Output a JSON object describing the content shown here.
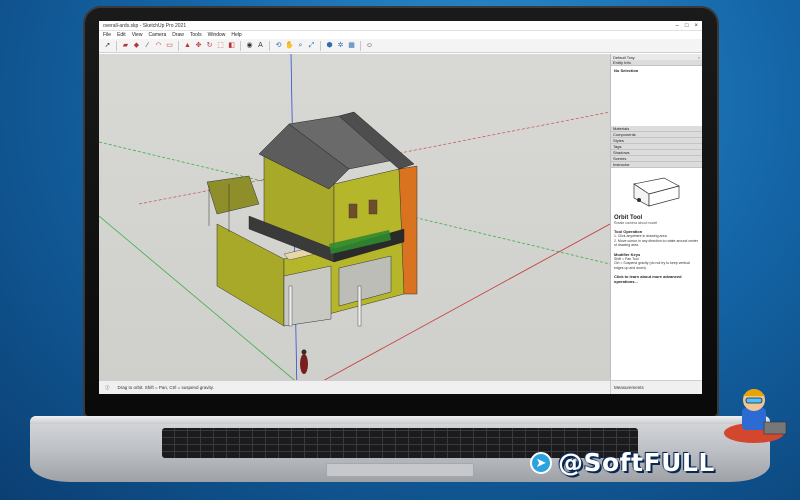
{
  "app": {
    "title": "overall-ards.skp - SketchUp Pro 2021",
    "menu": [
      "File",
      "Edit",
      "View",
      "Camera",
      "Draw",
      "Tools",
      "Window",
      "Help"
    ]
  },
  "toolbar": {
    "icons": [
      "select-icon",
      "eraser-icon",
      "paint-bucket-icon",
      "line-icon",
      "arc-icon",
      "shapes-icon",
      "push-pull-icon",
      "move-icon",
      "rotate-icon",
      "scale-icon",
      "offset-icon",
      "tape-measure-icon",
      "text-icon",
      "orbit-icon",
      "pan-icon",
      "zoom-icon",
      "zoom-extents-icon",
      "3d-warehouse-icon",
      "extension-warehouse-icon",
      "layout-icon",
      "account-icon"
    ]
  },
  "tray": {
    "header": "Default Tray",
    "entity_info": "Entity Info",
    "selection": "No Selection",
    "sections": [
      "Materials",
      "Components",
      "Styles",
      "Tags",
      "Shadows",
      "Scenes"
    ],
    "instructor_label": "Instructor",
    "tool_title": "Orbit Tool",
    "tool_subtitle": "Rotate camera about model",
    "operation_heading": "Tool Operation",
    "operation_steps": [
      "1. Click anywhere in drawing area.",
      "2. Move cursor in any direction to rotate around center of drawing area."
    ],
    "modifier_heading": "Modifier Keys",
    "modifier_lines": [
      "Shift = Pan Tool",
      "Ctrl = Suspend gravity (do not try to keep vertical edges up and down)."
    ],
    "learn_more": "Click to learn about more advanced operations..."
  },
  "status": {
    "hint": "Drag to orbit. Shift = Pan, Ctrl = suspend gravity.",
    "measurements_label": "Measurements"
  },
  "watermark": {
    "text": "@SoftFULL"
  },
  "colors": {
    "wall": "#b5b62a",
    "roof": "#5c5c5c",
    "orange_wall": "#d9731f",
    "viewport_bg": "#d8d8d4",
    "axis_red": "#c8363a",
    "axis_green": "#3fae49",
    "axis_blue": "#2d4fd1"
  }
}
